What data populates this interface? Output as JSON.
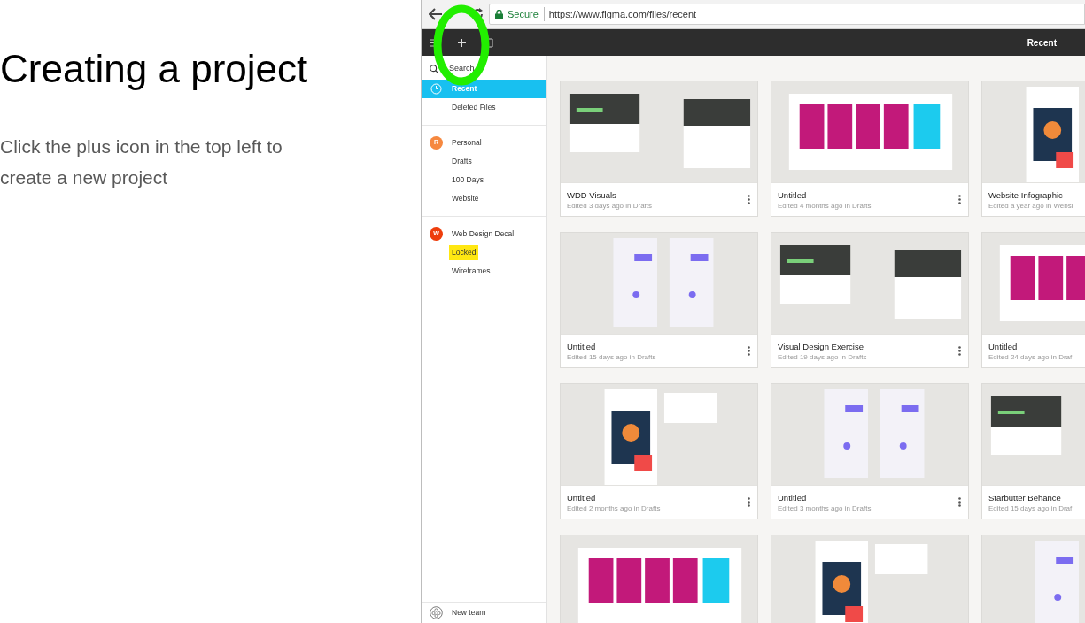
{
  "slide": {
    "title": "Creating a project",
    "body": "Click the plus icon in the top left to create a new project"
  },
  "browser": {
    "security": "Secure",
    "url": "https://www.figma.com/files/recent"
  },
  "header": {
    "title": "Recent"
  },
  "sidebar": {
    "search": {
      "placeholder": "Search"
    },
    "items": [
      {
        "label": "Recent",
        "selected": true
      },
      {
        "label": "Deleted Files",
        "selected": false
      }
    ],
    "teams": [
      {
        "name": "Personal",
        "initial": "R",
        "color": "#f6883f",
        "projects": [
          {
            "label": "Drafts",
            "highlighted": false
          },
          {
            "label": "100 Days",
            "highlighted": false
          },
          {
            "label": "Website",
            "highlighted": false
          }
        ]
      },
      {
        "name": "Web Design Decal",
        "initial": "W",
        "color": "#ee3d0c",
        "projects": [
          {
            "label": "Locked",
            "highlighted": true
          },
          {
            "label": "Wireframes",
            "highlighted": false
          }
        ]
      }
    ],
    "footer": "New team"
  },
  "files": [
    {
      "kind": "card",
      "title": "WDD Visuals",
      "meta": "Edited 3 days ago in Drafts"
    },
    {
      "kind": "card",
      "title": "Untitled",
      "meta": "Edited 4 months ago in Drafts"
    },
    {
      "kind": "card",
      "title": "Website Infographic",
      "meta": "Edited a year ago in Websi"
    },
    {
      "kind": "card",
      "title": "Untitled",
      "meta": "Edited 15 days ago in Drafts"
    },
    {
      "kind": "card",
      "title": "Visual Design Exercise",
      "meta": "Edited 19 days ago in Drafts"
    },
    {
      "kind": "card",
      "title": "Untitled",
      "meta": "Edited 24 days ago in Draf"
    },
    {
      "kind": "card",
      "title": "Untitled",
      "meta": "Edited 2 months ago in Drafts"
    },
    {
      "kind": "card",
      "title": "Untitled",
      "meta": "Edited 3 months ago in Drafts"
    },
    {
      "kind": "card",
      "title": "Starbutter Behance",
      "meta": "Edited 15 days ago in Draf"
    },
    {
      "kind": "picture"
    },
    {
      "kind": "picture"
    },
    {
      "kind": "picture"
    }
  ]
}
